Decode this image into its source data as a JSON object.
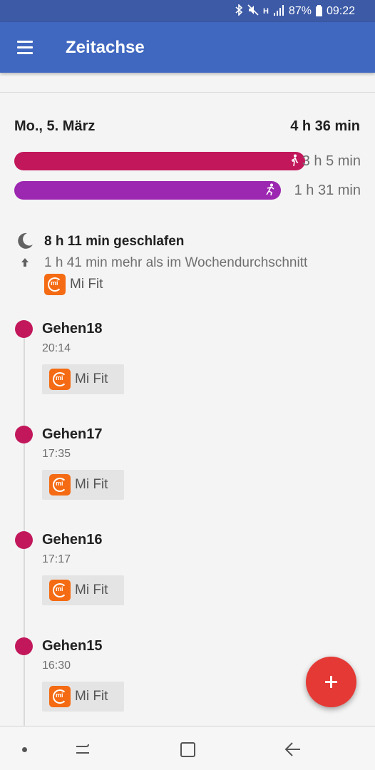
{
  "status_bar": {
    "icons": [
      "bluetooth-icon",
      "mute-icon",
      "network-h-icon",
      "signal-icon",
      "battery-icon"
    ],
    "network_type": "H",
    "battery": "87%",
    "time": "09:22"
  },
  "app_bar": {
    "title": "Zeitachse",
    "color": "#4168c0"
  },
  "summary": {
    "date": "Mo., 5. März",
    "total": "4 h 36 min",
    "bars": [
      {
        "label": "3 h 5 min",
        "color": "#c2185b",
        "icon": "walking-icon",
        "fraction": 0.84
      },
      {
        "label": "1 h 31 min",
        "color": "#9c27b0",
        "icon": "running-icon",
        "fraction": 0.77
      }
    ]
  },
  "sleep": {
    "title": "8 h 11 min geschlafen",
    "comparison": "1 h 41 min mehr als im Wochendurchschnitt",
    "source": "Mi Fit"
  },
  "timeline": [
    {
      "name": "Gehen18",
      "time": "20:14",
      "source": "Mi Fit"
    },
    {
      "name": "Gehen17",
      "time": "17:35",
      "source": "Mi Fit"
    },
    {
      "name": "Gehen16",
      "time": "17:17",
      "source": "Mi Fit"
    },
    {
      "name": "Gehen15",
      "time": "16:30",
      "source": "Mi Fit"
    }
  ],
  "fab": {
    "icon": "plus-icon",
    "color": "#e53935"
  },
  "nav_bar": {
    "buttons": [
      "nav-dot-icon",
      "recents-icon",
      "home-icon",
      "back-icon"
    ]
  }
}
